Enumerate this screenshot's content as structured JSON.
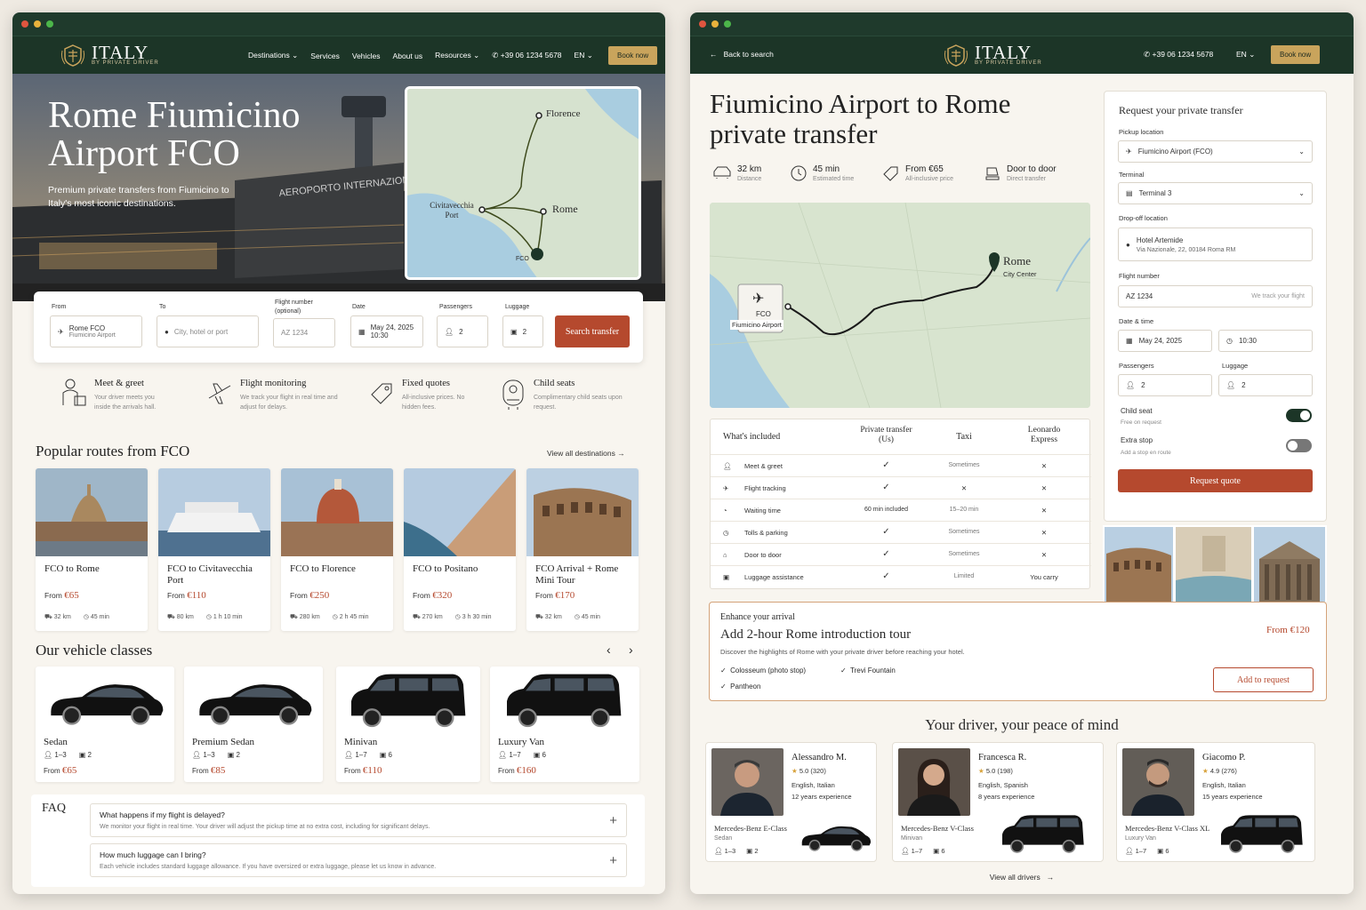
{
  "left": {
    "brand": "ITALY",
    "brand_sub": "BY PRIVATE DRIVER",
    "nav": {
      "destinations": "Destinations",
      "services": "Services",
      "vehicles": "Vehicles",
      "about": "About us",
      "resources": "Resources",
      "phone": "+39 06 1234 5678",
      "lang": "EN",
      "book": "Book now"
    },
    "hero": {
      "title": "Rome Fiumicino Airport FCO",
      "subtitle": "Premium private transfers from Fiumicino to Italy's most iconic destinations.",
      "sign": "AEROPORTO INTERNAZIONALE DI ROMA FIUMICINO"
    },
    "map": {
      "florence": "Florence",
      "civitavecchia": "Civitavecchia Port",
      "rome": "Rome",
      "fco": "FCO"
    },
    "form": {
      "from_label": "From",
      "from_value": "Rome FCO",
      "from_sub": "Fiumicino Airport",
      "to_label": "To",
      "to_placeholder": "City, hotel or port",
      "flight_label": "Flight number (optional)",
      "flight_placeholder": "AZ 1234",
      "date_label": "Date",
      "date_value": "May 24, 2025",
      "time_value": "10:30",
      "pass_label": "Passengers",
      "pass_value": "2",
      "lug_label": "Luggage",
      "lug_value": "2",
      "search": "Search transfer"
    },
    "features": [
      {
        "title": "Meet & greet",
        "desc": "Your driver meets you inside the arrivals hall.",
        "icon": "person-sign-icon"
      },
      {
        "title": "Flight monitoring",
        "desc": "We track your flight in real time and adjust for delays.",
        "icon": "plane-icon"
      },
      {
        "title": "Fixed quotes",
        "desc": "All-inclusive prices. No hidden fees.",
        "icon": "tag-icon"
      },
      {
        "title": "Child seats",
        "desc": "Complimentary child seats upon request.",
        "icon": "child-seat-icon"
      }
    ],
    "routes_title": "Popular routes from FCO",
    "view_all": "View all destinations",
    "routes": [
      {
        "name": "FCO to Rome",
        "from": "From",
        "price": "€65",
        "km": "32 km",
        "time": "45 min"
      },
      {
        "name": "FCO to Civitavecchia Port",
        "from": "From",
        "price": "€110",
        "km": "80 km",
        "time": "1 h 10 min"
      },
      {
        "name": "FCO to Florence",
        "from": "From",
        "price": "€250",
        "km": "280 km",
        "time": "2 h 45 min"
      },
      {
        "name": "FCO to Positano",
        "from": "From",
        "price": "€320",
        "km": "270 km",
        "time": "3 h 30 min"
      },
      {
        "name": "FCO Arrival + Rome Mini Tour",
        "from": "From",
        "price": "€170",
        "km": "32 km",
        "time": "45 min"
      }
    ],
    "vehicles_title": "Our vehicle classes",
    "vehicles": [
      {
        "name": "Sedan",
        "pax": "1–3",
        "bags": "2",
        "from": "From",
        "price": "€65"
      },
      {
        "name": "Premium Sedan",
        "pax": "1–3",
        "bags": "2",
        "from": "From",
        "price": "€85"
      },
      {
        "name": "Minivan",
        "pax": "1–7",
        "bags": "6",
        "from": "From",
        "price": "€110"
      },
      {
        "name": "Luxury Van",
        "pax": "1–7",
        "bags": "6",
        "from": "From",
        "price": "€160"
      }
    ],
    "faq_title": "FAQ",
    "faq": [
      {
        "q": "What happens if my flight is delayed?",
        "a": "We monitor your flight in real time. Your driver will adjust the pickup time at no extra cost, including for significant delays."
      },
      {
        "q": "How much luggage can I bring?",
        "a": "Each vehicle includes standard luggage allowance. If you have oversized or extra luggage, please let us know in advance."
      }
    ]
  },
  "right": {
    "back": "Back to search",
    "phone": "+39 06 1234 5678",
    "lang": "EN",
    "book": "Book now",
    "title": "Fiumicino Airport to Rome private transfer",
    "stats": [
      {
        "value": "32 km",
        "sub": "Distance",
        "icon": "car-icon"
      },
      {
        "value": "45 min",
        "sub": "Estimated time",
        "icon": "clock-icon"
      },
      {
        "value": "From €65",
        "sub": "All-inclusive price",
        "icon": "tag-icon"
      },
      {
        "value": "Door to door",
        "sub": "Direct transfer",
        "icon": "seat-icon"
      }
    ],
    "map": {
      "rome": "Rome",
      "rome_sub": "City Center",
      "fco": "FCO",
      "fco_sub": "Fiumicino Airport"
    },
    "table": {
      "head": [
        "What's included",
        "Private transfer (Us)",
        "Taxi",
        "Leonardo Express"
      ],
      "rows": [
        {
          "label": "Meet & greet",
          "us": "✓",
          "taxi": "Sometimes",
          "train": "✕"
        },
        {
          "label": "Flight tracking",
          "us": "✓",
          "taxi": "✕",
          "train": "✕"
        },
        {
          "label": "Waiting time",
          "us": "60 min included",
          "taxi": "15–20 min",
          "train": "✕"
        },
        {
          "label": "Tolls & parking",
          "us": "✓",
          "taxi": "Sometimes",
          "train": "✕"
        },
        {
          "label": "Door to door",
          "us": "✓",
          "taxi": "Sometimes",
          "train": "✕"
        },
        {
          "label": "Luggage assistance",
          "us": "✓",
          "taxi": "Limited",
          "train": "You carry"
        }
      ]
    },
    "request": {
      "title": "Request your private transfer",
      "pickup_label": "Pickup location",
      "pickup_value": "Fiumicino Airport (FCO)",
      "terminal_label": "Terminal",
      "terminal_value": "Terminal 3",
      "dropoff_label": "Drop-off location",
      "dropoff_value": "Hotel Artemide",
      "dropoff_sub": "Via Nazionale, 22, 00184 Roma RM",
      "flight_label": "Flight number",
      "flight_value": "AZ 1234",
      "flight_hint": "We track your flight",
      "dt_label": "Date & time",
      "date": "May 24, 2025",
      "time": "10:30",
      "pass_label": "Passengers",
      "pass_value": "2",
      "lug_label": "Luggage",
      "lug_value": "2",
      "child_label": "Child seat",
      "child_sub": "Free on request",
      "extra_label": "Extra stop",
      "extra_sub": "Add a stop en route",
      "submit": "Request quote"
    },
    "tour": {
      "eyebrow": "Enhance your arrival",
      "title": "Add 2-hour Rome introduction tour",
      "desc": "Discover the highlights of Rome with your private driver before reaching your hotel.",
      "items": [
        "Colosseum (photo stop)",
        "Trevi Fountain",
        "Pantheon"
      ],
      "price": "From €120",
      "cta": "Add to request"
    },
    "drivers_title": "Your driver, your peace of mind",
    "drivers": [
      {
        "name": "Alessandro M.",
        "rating": "5.0 (320)",
        "langs": "English, Italian",
        "exp": "12 years experience",
        "car": "Mercedes-Benz E-Class",
        "class": "Sedan",
        "pax": "1–3",
        "bags": "2"
      },
      {
        "name": "Francesca R.",
        "rating": "5.0 (198)",
        "langs": "English, Spanish",
        "exp": "8 years experience",
        "car": "Mercedes-Benz V-Class",
        "class": "Minivan",
        "pax": "1–7",
        "bags": "6"
      },
      {
        "name": "Giacomo P.",
        "rating": "4.9 (276)",
        "langs": "English, Italian",
        "exp": "15 years experience",
        "car": "Mercedes-Benz V-Class XL",
        "class": "Luxury Van",
        "pax": "1–7",
        "bags": "6"
      }
    ],
    "view_drivers": "View all drivers"
  },
  "colors": {
    "green": "#1c3527",
    "gold": "#c9a45c",
    "accent": "#b5492e",
    "cream": "#f8f5ef"
  }
}
